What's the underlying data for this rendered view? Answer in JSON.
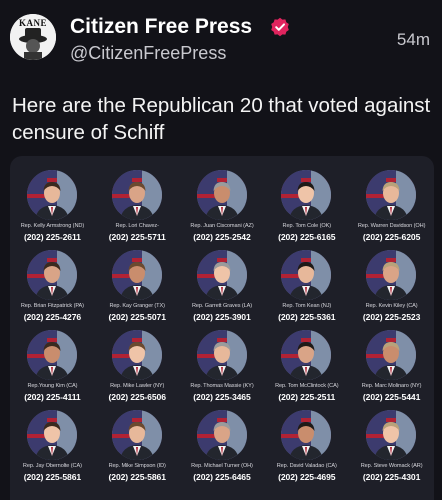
{
  "post": {
    "display_name": "Citizen Free Press",
    "handle": "@CitizenFreePress",
    "time": "54m",
    "avatar_text": "KANE",
    "text": "Here are the Republican 20 that voted against censure of Schiff"
  },
  "members": [
    {
      "name": "Rep. Kelly Armstrong (ND)",
      "phone": "(202) 225-2611"
    },
    {
      "name": "Rep. Lori Chavez-",
      "phone": "(202) 225-5711"
    },
    {
      "name": "Rep. Juan Ciscomani (AZ)",
      "phone": "(202) 225-2542"
    },
    {
      "name": "Rep. Tom Cole (OK)",
      "phone": "(202) 225-6165"
    },
    {
      "name": "Rep. Warren Davidson (OH)",
      "phone": "(202) 225-6205"
    },
    {
      "name": "Rep. Brian Fitzpatrick (PA)",
      "phone": "(202) 225-4276"
    },
    {
      "name": "Rep. Kay Granger (TX)",
      "phone": "(202) 225-5071"
    },
    {
      "name": "Rep. Garrett Graves (LA)",
      "phone": "(202) 225-3901"
    },
    {
      "name": "Rep. Tom Kean (NJ)",
      "phone": "(202) 225-5361"
    },
    {
      "name": "Rep. Kevin Kiley (CA)",
      "phone": "(202) 225-2523"
    },
    {
      "name": "Rep.Young Kim (CA)",
      "phone": "(202) 225-4111"
    },
    {
      "name": "Rep. Mike Lawler (NY)",
      "phone": "(202) 225-6506"
    },
    {
      "name": "Rep. Thomas Massie (KY)",
      "phone": "(202) 225-3465"
    },
    {
      "name": "Rep. Tom McClintock (CA)",
      "phone": "(202) 225-2511"
    },
    {
      "name": "Rep. Marc Molinaro (NY)",
      "phone": "(202) 225-5441"
    },
    {
      "name": "Rep. Jay Obernolte (CA)",
      "phone": "(202) 225-5861"
    },
    {
      "name": "Rep. Mike Simpson (ID)",
      "phone": "(202) 225-5861"
    },
    {
      "name": "Rep. Michael Turner (OH)",
      "phone": "(202) 225-6465"
    },
    {
      "name": "Rep. David Valadao (CA)",
      "phone": "(202) 225-4695"
    },
    {
      "name": "Rep. Steve Womack (AR)",
      "phone": "(202) 225-4301"
    }
  ],
  "colors": {
    "background": "#121218",
    "card": "#1e1f28",
    "verified": "#e0245e",
    "flag_red": "#b22234",
    "flag_blue": "#3c3b6e",
    "suit": "#23262e"
  }
}
